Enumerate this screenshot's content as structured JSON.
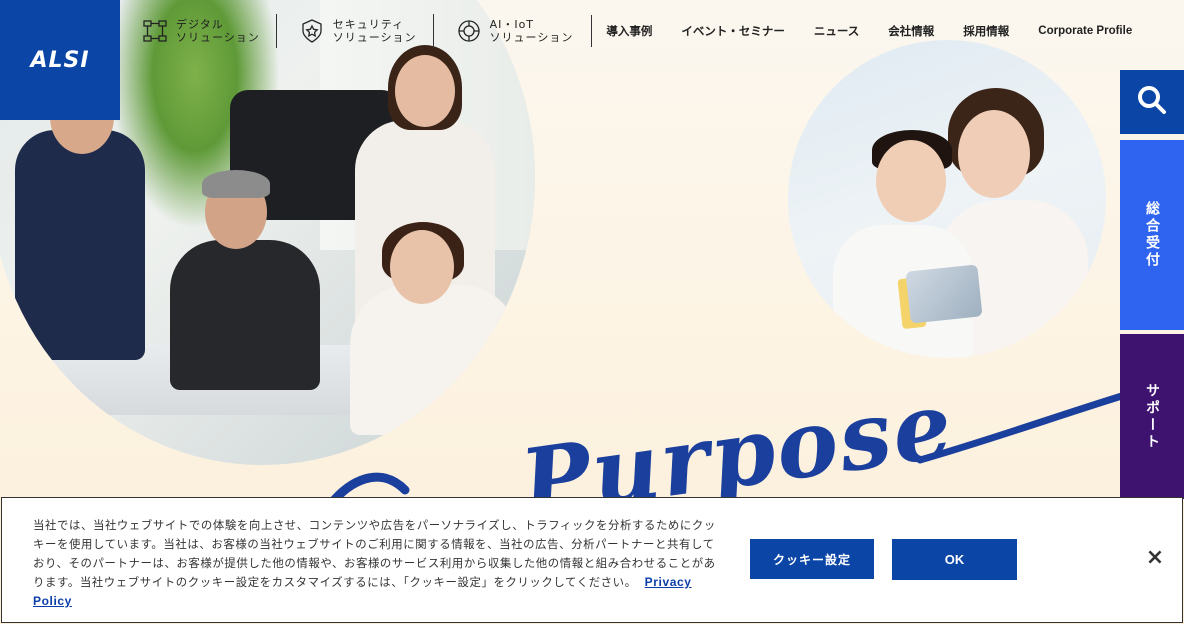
{
  "logo": {
    "text": "ALSI"
  },
  "nav": {
    "solutions": [
      {
        "label_line1": "デジタル",
        "label_line2": "ソリューション",
        "icon": "network-icon"
      },
      {
        "label_line1": "セキュリティ",
        "label_line2": "ソリューション",
        "icon": "shield-star-icon"
      },
      {
        "label_line1": "AI・IoT",
        "label_line2": "ソリューション",
        "icon": "ai-chip-icon"
      }
    ],
    "links": [
      "導入事例",
      "イベント・セミナー",
      "ニュース",
      "会社情報",
      "採用情報",
      "Corporate Profile"
    ]
  },
  "side": {
    "search_icon": "search-icon",
    "contact_label": "総合受付",
    "support_label": "サポート"
  },
  "hero": {
    "script_text": "Purpose"
  },
  "cookie": {
    "text": "当社では、当社ウェブサイトでの体験を向上させ、コンテンツや広告をパーソナライズし、トラフィックを分析するためにクッキーを使用しています。当社は、お客様の当社ウェブサイトのご利用に関する情報を、当社の広告、分析パートナーと共有しており、そのパートナーは、お客様が提供した他の情報や、お客様のサービス利用から収集した他の情報と組み合わせることがあります。当社ウェブサイトのクッキー設定をカスタマイズするには、「クッキー設定」をクリックしてください。",
    "privacy_link": "Privacy Policy",
    "settings_label": "クッキー設定",
    "ok_label": "OK",
    "close_label": "×"
  }
}
